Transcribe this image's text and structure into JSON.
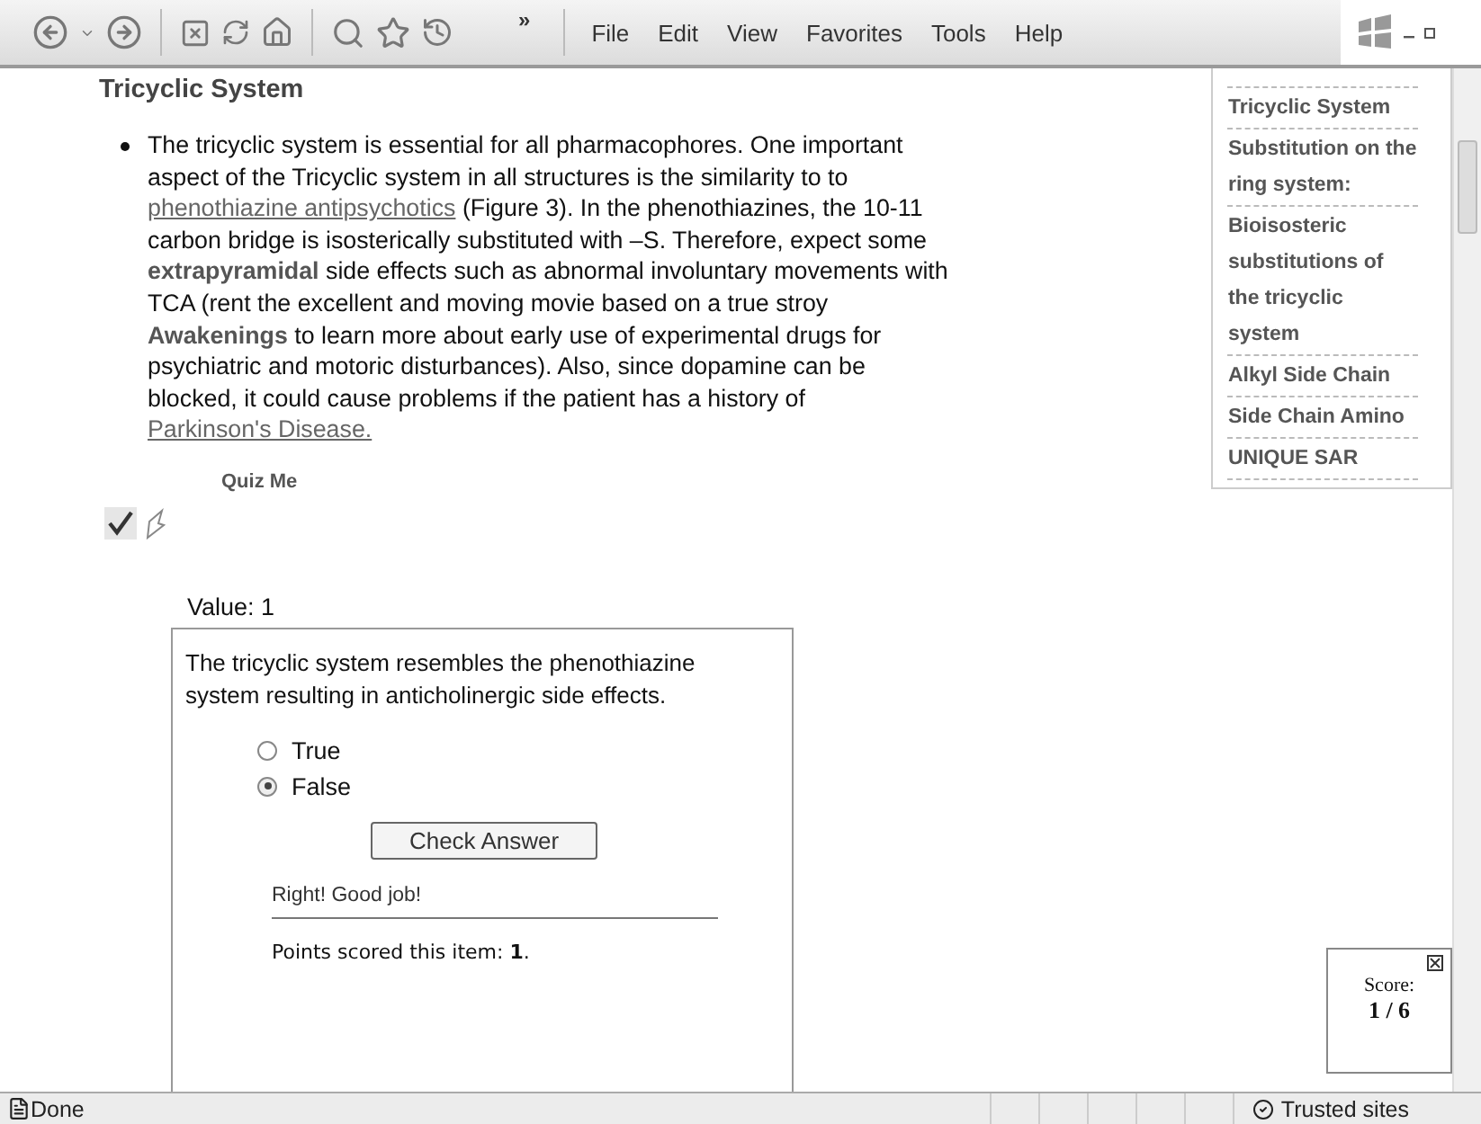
{
  "toolbar": {
    "overflow": "»",
    "menu": [
      "File",
      "Edit",
      "View",
      "Favorites",
      "Tools",
      "Help"
    ]
  },
  "article": {
    "heading": "Tricyclic System",
    "paragraph": [
      {
        "kind": "text",
        "text": "The tricyclic system is essential for all pharmacophores.  One important aspect of the Tricyclic system in all structures is the similarity to to "
      },
      {
        "kind": "link",
        "text": "phenothiazine antipsychotics"
      },
      {
        "kind": "text",
        "text": " (Figure 3). In the phenothiazines, the 10-11 carbon bridge is isosterically substituted with –S.  Therefore, expect some **extrapyramidal** side effects such as abnormal involuntary movements with TCA (rent the excellent and moving movie based on a true stroy **Awakenings** to learn more about early use of experimental drugs for psychiatric and motoric disturbances).  Also, since dopamine can be blocked, it could cause problems if the patient has a history of "
      },
      {
        "kind": "link",
        "text": "Parkinson's Disease."
      }
    ],
    "quiz_link": "Quiz Me"
  },
  "quiz": {
    "value_label": "Value: 1",
    "question": "The tricyclic system resembles the phenothiazine system resulting in anticholinergic side effects.",
    "options": [
      {
        "label": "True",
        "selected": false
      },
      {
        "label": "False",
        "selected": true
      }
    ],
    "button": "Check Answer",
    "feedback": "Right! Good job!",
    "points": "Points scored this item: **1**."
  },
  "sidebar": {
    "items": [
      "Tricyclic System",
      "Substitution on the ring system:",
      "Bioisosteric substitutions of the tricyclic system",
      "Alkyl Side Chain",
      "Side Chain Amino",
      "UNIQUE SAR"
    ]
  },
  "score": {
    "label": "Score:",
    "value": "1 / 6"
  },
  "status_bar": {
    "status": "Done",
    "zone": "Trusted sites"
  }
}
